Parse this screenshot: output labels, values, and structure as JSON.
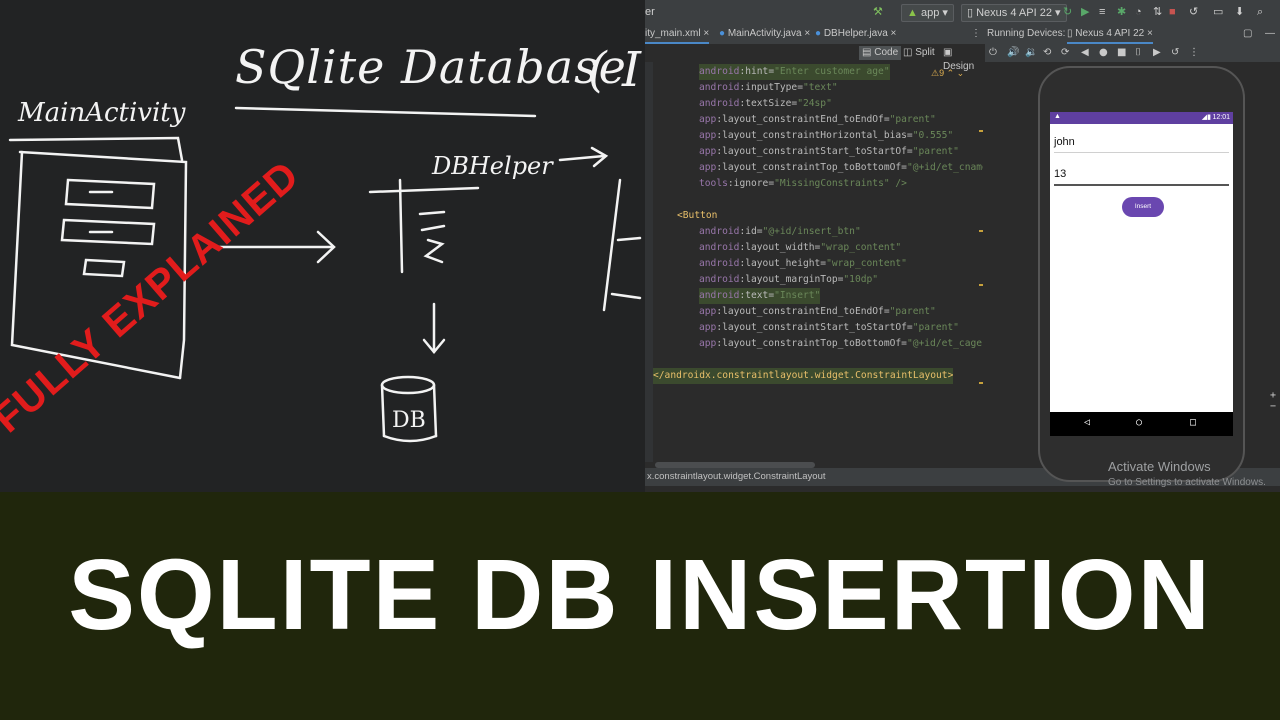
{
  "whiteboard": {
    "title": "SQlite Database",
    "main_label": "MainActivity",
    "dbhelper_label": "DBHelper",
    "db_label": "DB",
    "paren": "( I"
  },
  "ide": {
    "toolbar": {
      "left_fragment": "er",
      "run_config": "app",
      "device": "Nexus 4 API 22"
    },
    "tabs": [
      {
        "label": "ity_main.xml",
        "active": true
      },
      {
        "label": "MainActivity.java",
        "active": false
      },
      {
        "label": "DBHelper.java",
        "active": false
      }
    ],
    "running_devices_label": "Running Devices:",
    "device_tab": "Nexus 4 API 22",
    "view_modes": [
      "Code",
      "Split",
      "Design"
    ],
    "warning_count": "9",
    "code_lines": [
      [
        "android",
        ":hint=",
        "\"Enter customer age\""
      ],
      [
        "android",
        ":inputType=",
        "\"text\""
      ],
      [
        "android",
        ":textSize=",
        "\"24sp\""
      ],
      [
        "app",
        ":layout_constraintEnd_toEndOf=",
        "\"parent\""
      ],
      [
        "app",
        ":layout_constraintHorizontal_bias=",
        "\"0.555\""
      ],
      [
        "app",
        ":layout_constraintStart_toStartOf=",
        "\"parent\""
      ],
      [
        "app",
        ":layout_constraintTop_toBottomOf=",
        "\"@+id/et_cname\""
      ],
      [
        "tools",
        ":ignore=",
        "\"MissingConstraints\" />"
      ],
      [
        "",
        "",
        ""
      ],
      [
        "",
        "<Button",
        ""
      ],
      [
        "android",
        ":id=",
        "\"@+id/insert_btn\""
      ],
      [
        "android",
        ":layout_width=",
        "\"wrap_content\""
      ],
      [
        "android",
        ":layout_height=",
        "\"wrap_content\""
      ],
      [
        "android",
        ":layout_marginTop=",
        "\"10dp\""
      ],
      [
        "android",
        ":text=",
        "\"Insert\""
      ],
      [
        "app",
        ":layout_constraintEnd_toEndOf=",
        "\"parent\""
      ],
      [
        "app",
        ":layout_constraintStart_toStartOf=",
        "\"parent\""
      ],
      [
        "app",
        ":layout_constraintTop_toBottomOf=",
        "\"@+id/et_cage\""
      ],
      [
        "",
        "",
        ""
      ],
      [
        "",
        "</androidx.constraintlayout.widget.ConstraintLayout>",
        ""
      ]
    ],
    "status_bar": "x.constraintlayout.widget.ConstraintLayout"
  },
  "emulator": {
    "status_time": "12:01",
    "name_value": "john",
    "age_value": "13",
    "insert_label": "Insert"
  },
  "watermark": {
    "line1": "Activate Windows",
    "line2": "Go to Settings to activate Windows."
  },
  "banner": {
    "title": "SQLITE DB INSERTION",
    "stamp": "FULLY EXPLAINED"
  },
  "colors": {
    "banner_bg": "#20260c",
    "stamp_red": "#e11c1c",
    "emulator_purple": "#6a47b0"
  }
}
